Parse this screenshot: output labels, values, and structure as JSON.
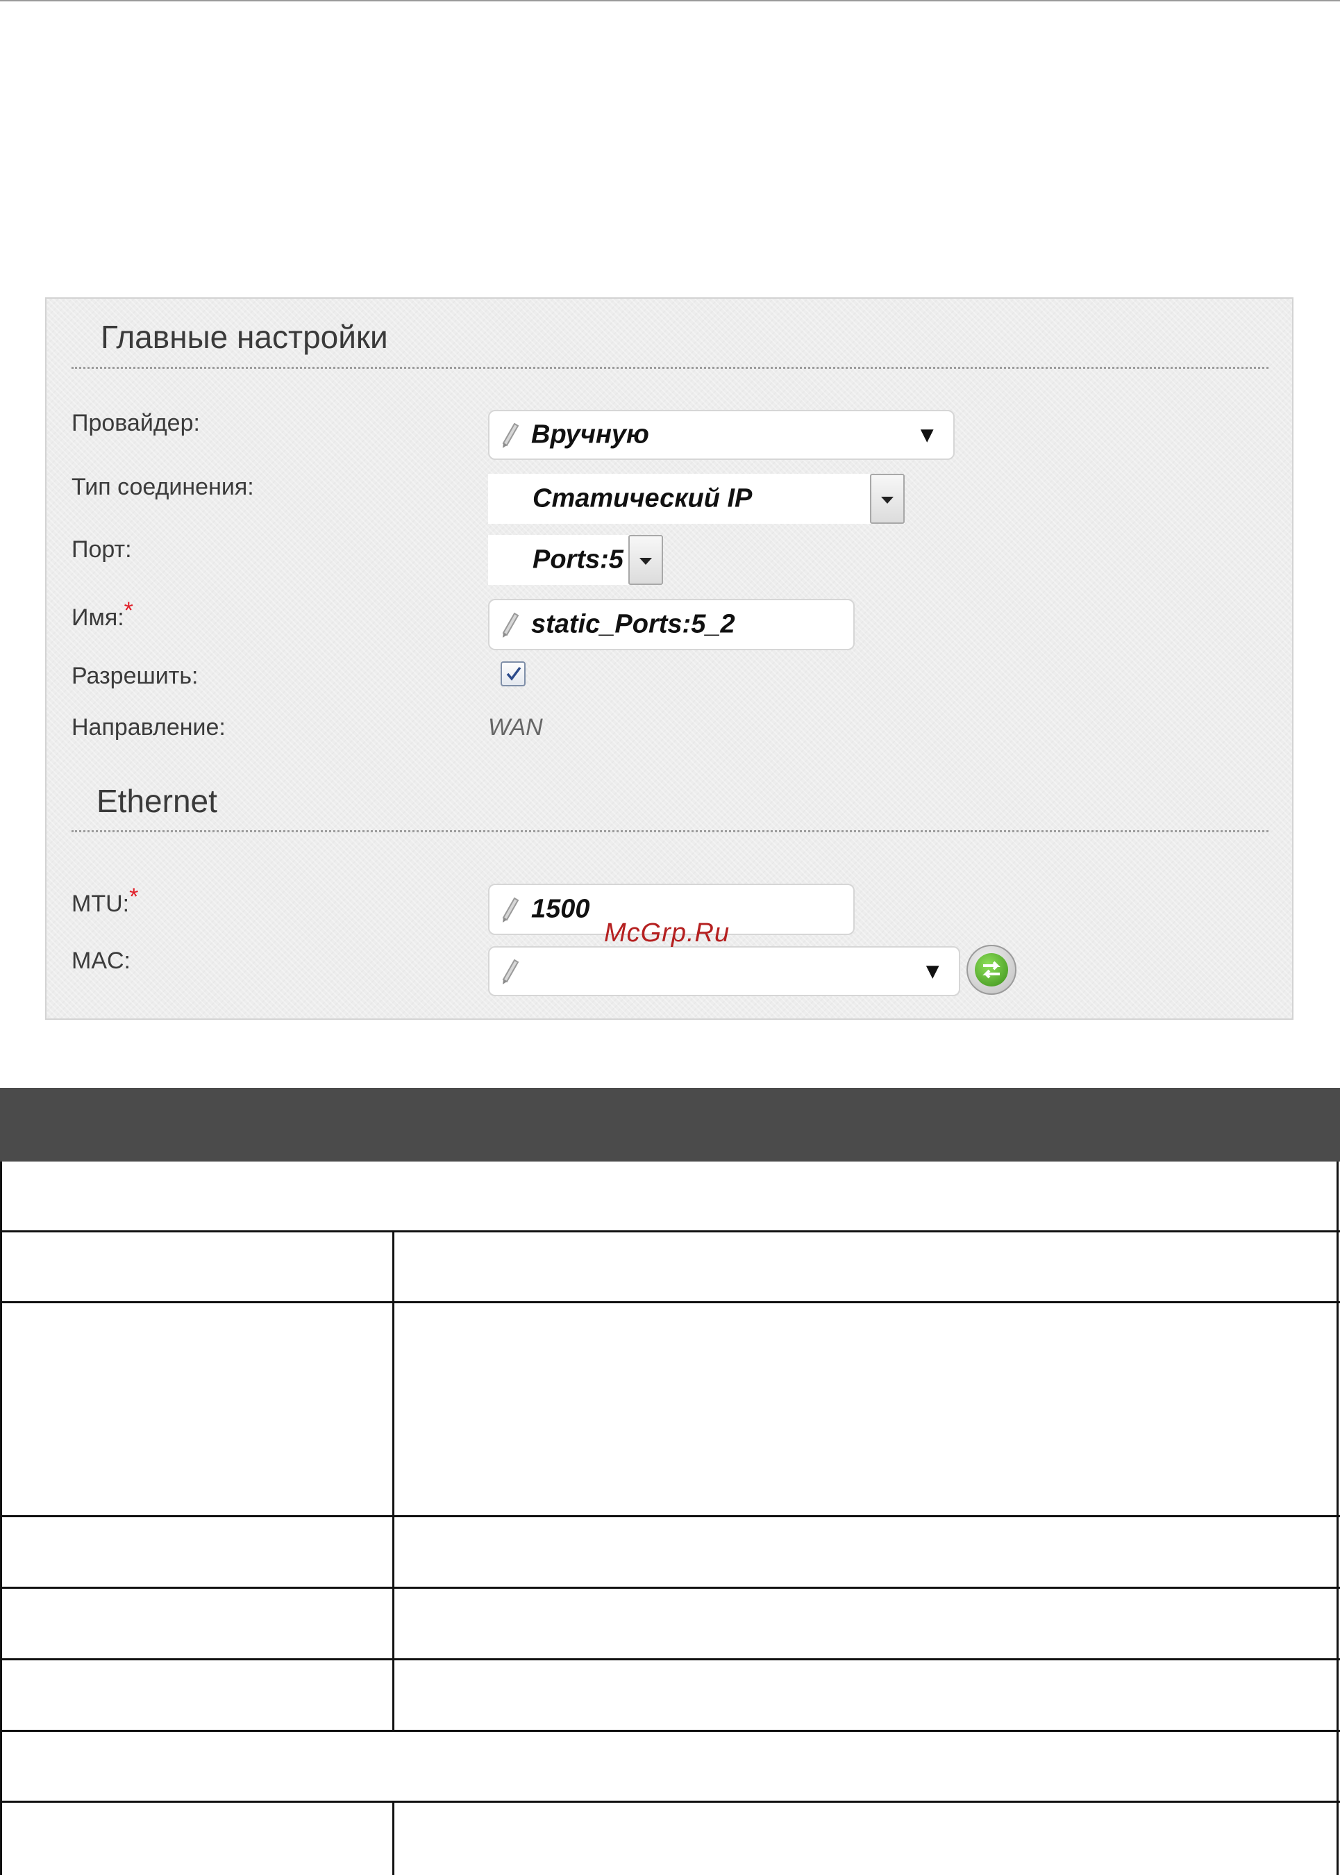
{
  "panel": {
    "main_section_title": "Главные настройки",
    "ethernet_section_title": "Ethernet",
    "provider": {
      "label": "Провайдер:",
      "value": "Вручную"
    },
    "connection_type": {
      "label": "Тип соединения:",
      "value": "Статический IP"
    },
    "port": {
      "label": "Порт:",
      "value": "Ports:5"
    },
    "name": {
      "label": "Имя:",
      "required_mark": "*",
      "value": "static_Ports:5_2"
    },
    "enable": {
      "label": "Разрешить:",
      "checked": true
    },
    "direction": {
      "label": "Направление:",
      "value": "WAN"
    },
    "mtu": {
      "label": "MTU:",
      "required_mark": "*",
      "value": "1500"
    },
    "mac": {
      "label": "MAC:",
      "value": ""
    }
  },
  "watermark": "McGrp.Ru",
  "icons": {
    "pencil": "pencil-icon",
    "dropdown": "chevron-down-icon",
    "refresh": "refresh-arrows-icon",
    "checkbox": "checkmark-icon"
  },
  "colors": {
    "table_header": "#4b4b4b",
    "required_mark": "#e0202a",
    "watermark": "#b52020",
    "refresh_button": "#4caf26"
  }
}
